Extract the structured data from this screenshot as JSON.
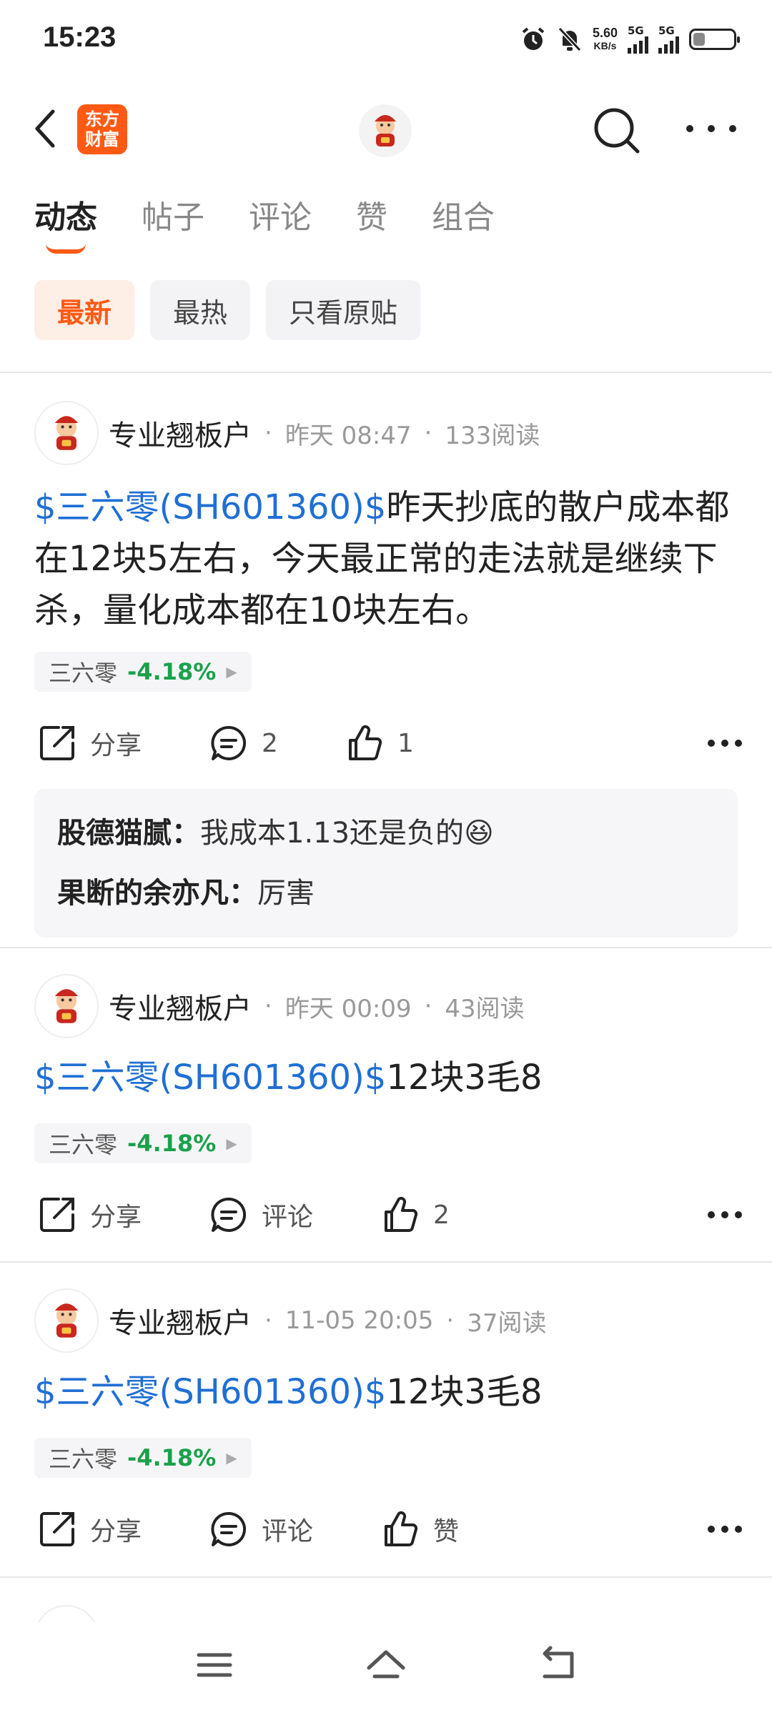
{
  "status_bar": {
    "time": "15:23",
    "net_speed_value": "5.60",
    "net_speed_unit": "KB/s",
    "sim1_label": "5G",
    "sim2_label": "5G",
    "battery_level": 0.3
  },
  "header": {
    "logo_text_line1": "东方",
    "logo_text_line2": "财富"
  },
  "tabs": [
    {
      "label": "动态",
      "active": true
    },
    {
      "label": "帖子",
      "active": false
    },
    {
      "label": "评论",
      "active": false
    },
    {
      "label": "赞",
      "active": false
    },
    {
      "label": "组合",
      "active": false
    }
  ],
  "filters": [
    {
      "label": "最新",
      "active": true
    },
    {
      "label": "最热",
      "active": false
    },
    {
      "label": "只看原贴",
      "active": false
    }
  ],
  "posts": [
    {
      "author": "专业翘板户",
      "time": "昨天 08:47",
      "reads": "133阅读",
      "stock_link": "$三六零(SH601360)$",
      "text": "昨天抄底的散户成本都在12块5左右，今天最正常的走法就是继续下杀，量化成本都在10块左右。",
      "tag_name": "三六零",
      "tag_change": "-4.18%",
      "share_label": "分享",
      "comment_label": "2",
      "like_label": "1",
      "comments": [
        {
          "name": "股德猫腻：",
          "text": "我成本1.13还是负的",
          "emoji": "😆"
        },
        {
          "name": "果断的余亦凡：",
          "text": "厉害"
        }
      ]
    },
    {
      "author": "专业翘板户",
      "time": "昨天 00:09",
      "reads": "43阅读",
      "stock_link": "$三六零(SH601360)$",
      "text": "12块3毛8",
      "tag_name": "三六零",
      "tag_change": "-4.18%",
      "share_label": "分享",
      "comment_label": "评论",
      "like_label": "2"
    },
    {
      "author": "专业翘板户",
      "time": "11-05 20:05",
      "reads": "37阅读",
      "stock_link": "$三六零(SH601360)$",
      "text": "12块3毛8",
      "tag_name": "三六零",
      "tag_change": "-4.18%",
      "share_label": "分享",
      "comment_label": "评论",
      "like_label": "赞"
    }
  ],
  "meta_separator": "·",
  "colors": {
    "accent": "#ff5a14",
    "link": "#1f6fd4",
    "down": "#1aa14b"
  }
}
